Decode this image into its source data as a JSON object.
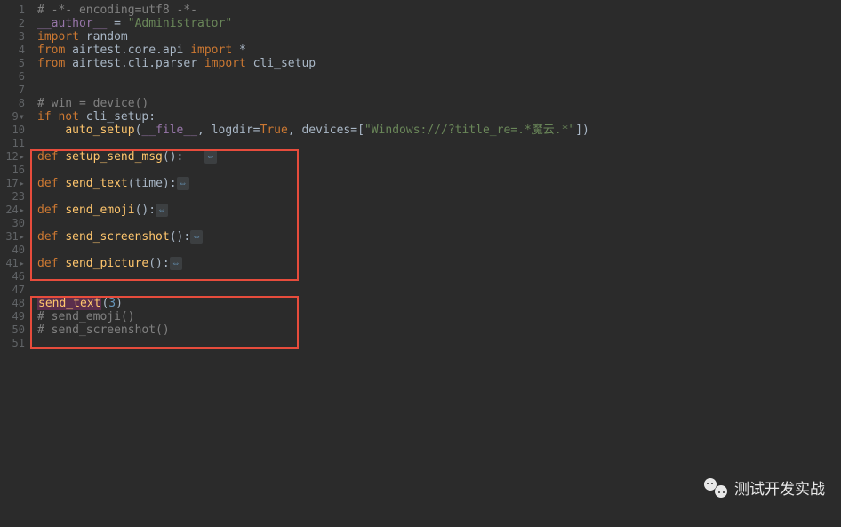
{
  "gutter": [
    "1",
    "2",
    "3",
    "4",
    "5",
    "6",
    "7",
    "8",
    "9▾",
    "10",
    "11",
    "12▸",
    "16",
    "17▸",
    "23",
    "24▸",
    "30",
    "31▸",
    "40",
    "41▸",
    "46",
    "47",
    "48",
    "49",
    "50",
    "51"
  ],
  "code": {
    "l1_comment": "# -*- encoding=utf8 -*-",
    "l2_author": "__author__",
    "l2_eq": " = ",
    "l2_val": "\"Administrator\"",
    "l3_import": "import",
    "l3_mod": " random",
    "l4_from": "from",
    "l4_mod": " airtest.core.api ",
    "l4_import": "import",
    "l4_star": " *",
    "l5_from": "from",
    "l5_mod": " airtest.cli.parser ",
    "l5_import": "import",
    "l5_name": " cli_setup",
    "l8_comment": "# win = device()",
    "l9_if": "if not",
    "l9_cond": " cli_setup:",
    "l10_indent": "    ",
    "l10_fn": "auto_setup",
    "l10_p1": "(",
    "l10_file": "__file__",
    "l10_c1": ", logdir=",
    "l10_true": "True",
    "l10_c2": ", devices=[",
    "l10_str": "\"Windows:///?title_re=.*魔云.*\"",
    "l10_p2": "])",
    "def": "def",
    "f12": "setup_send_msg",
    "f12_sig": "():   ",
    "f17": "send_text",
    "f17_sig": "(time):",
    "f24": "send_emoji",
    "f24_sig": "():",
    "f31": "send_screenshot",
    "f31_sig": "():",
    "f41": "send_picture",
    "f41_sig": "():",
    "fold": "⇔",
    "l48_call": "send_text",
    "l48_p1": "(",
    "l48_arg": "3",
    "l48_p2": ")",
    "l49_comment": "# send_emoji()",
    "l50_comment": "# send_screenshot()"
  },
  "watermark": "测试开发实战"
}
